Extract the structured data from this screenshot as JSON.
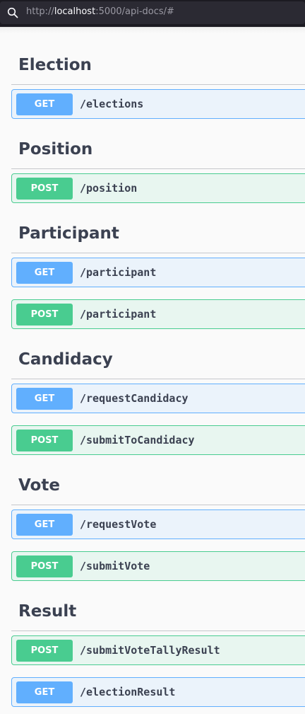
{
  "browser": {
    "url_prefix": "http://",
    "url_host": "localhost",
    "url_rest": ":5000/api-docs/#"
  },
  "sections": [
    {
      "title": "Election",
      "operations": [
        {
          "method": "GET",
          "path": "/elections"
        }
      ]
    },
    {
      "title": "Position",
      "operations": [
        {
          "method": "POST",
          "path": "/position"
        }
      ]
    },
    {
      "title": "Participant",
      "operations": [
        {
          "method": "GET",
          "path": "/participant"
        },
        {
          "method": "POST",
          "path": "/participant"
        }
      ]
    },
    {
      "title": "Candidacy",
      "operations": [
        {
          "method": "GET",
          "path": "/requestCandidacy"
        },
        {
          "method": "POST",
          "path": "/submitToCandidacy"
        }
      ]
    },
    {
      "title": "Vote",
      "operations": [
        {
          "method": "GET",
          "path": "/requestVote"
        },
        {
          "method": "POST",
          "path": "/submitVote"
        }
      ]
    },
    {
      "title": "Result",
      "operations": [
        {
          "method": "POST",
          "path": "/submitVoteTallyResult"
        },
        {
          "method": "GET",
          "path": "/electionResult"
        }
      ]
    }
  ]
}
